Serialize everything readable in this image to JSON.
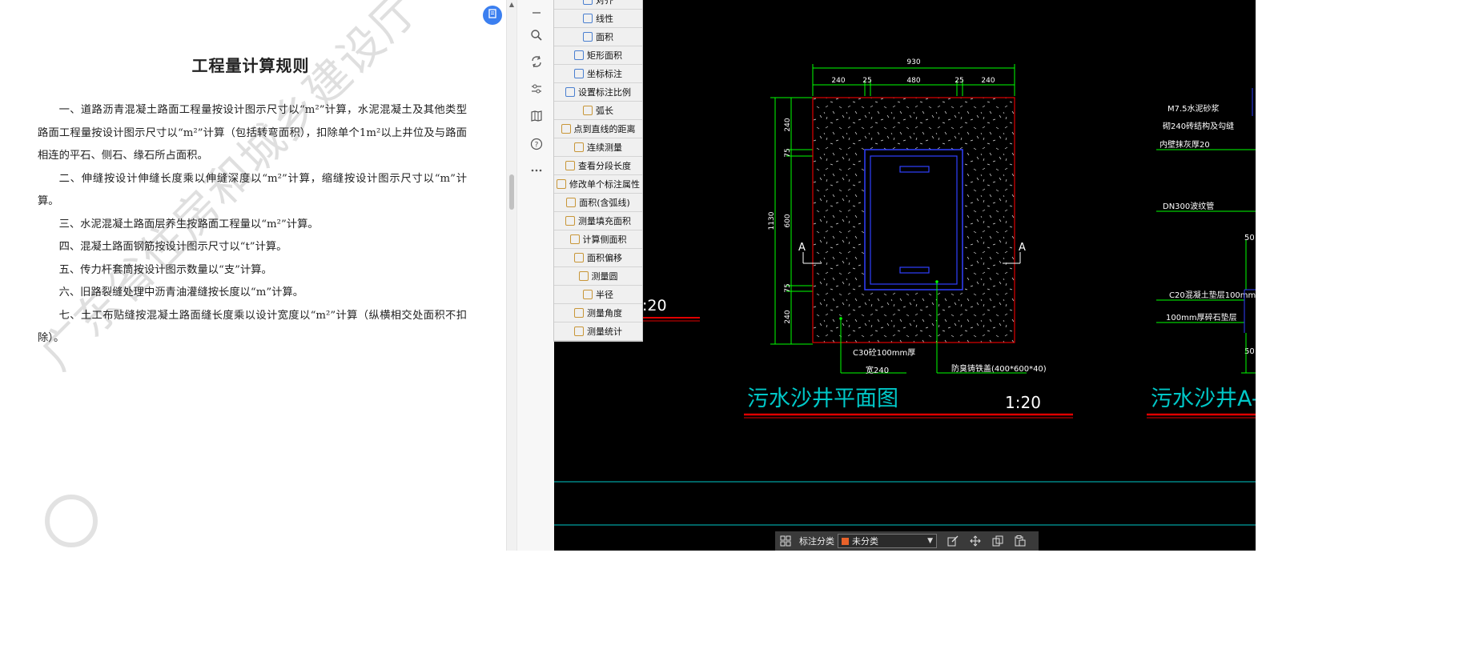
{
  "document": {
    "title": "工程量计算规则",
    "paragraphs": [
      "一、道路沥青混凝土路面工程量按设计图示尺寸以“m²”计算，水泥混凝土及其他类型路面工程量按设计图示尺寸以“m²”计算（包括转弯面积），扣除单个1m²以上井位及与路面相连的平石、侧石、缘石所占面积。",
      "二、伸缝按设计伸缝长度乘以伸缝深度以“m²”计算，缩缝按设计图示尺寸以“m”计算。",
      "三、水泥混凝土路面层养生按路面工程量以“m²”计算。",
      "四、混凝土路面钢筋按设计图示尺寸以“t”计算。",
      "五、传力杆套筒按设计图示数量以“支”计算。",
      "六、旧路裂缝处理中沥青油灌缝按长度以“m”计算。",
      "七、土工布贴缝按混凝土路面缝长度乘以设计宽度以“m²”计算（纵横相交处面积不扣除）。"
    ],
    "watermark": "广东省住房和城乡建设厅"
  },
  "tool_column": {
    "icons": [
      "minus-icon",
      "search-icon",
      "rotate-icon",
      "settings-sliders-icon",
      "map-book-icon",
      "help-icon",
      "more-icon"
    ]
  },
  "measure_menu": {
    "items": [
      "对齐",
      "线性",
      "面积",
      "矩形面积",
      "坐标标注",
      "设置标注比例",
      "弧长",
      "点到直线的距离",
      "连续测量",
      "查看分段长度",
      "修改单个标注属性",
      "面积(含弧线)",
      "测量填充面积",
      "计算侧面积",
      "面积偏移",
      "测量圆",
      "半径",
      "测量角度",
      "测量统计"
    ]
  },
  "cad": {
    "plan_title": "污水沙井平面图",
    "plan_scale": "1:20",
    "left_scale": ":20",
    "section_title": "污水沙井A-",
    "dims_top": [
      "930",
      "240",
      "25",
      "480",
      "25",
      "240"
    ],
    "dims_left": [
      "240",
      "75",
      "600",
      "75",
      "240"
    ],
    "dim_total_left": "1130",
    "section_marks": [
      "A",
      "A"
    ],
    "labels": {
      "c30": "C30砼100mm厚",
      "wall": "宽240",
      "cover": "防臭铸铁盖(400*600*40)",
      "m75": "M7.5水泥砂浆",
      "brick": "砌240砖结构及勾缝",
      "plaster": "内壁抹灰厚20",
      "dn300": "DN300波纹管",
      "c20": "C20混凝土垫层100mm",
      "gravel": "100mm厚碎石垫层",
      "n50a": "50",
      "n50b": "50"
    },
    "colors": {
      "yellow": "#ffff00",
      "green": "#00ff00",
      "cyan": "#00c8c8",
      "red": "#e00000",
      "blue": "#3040ff",
      "white": "#ffffff"
    }
  },
  "bottom_toolbar": {
    "label": "标注分类",
    "selected": "未分类"
  }
}
